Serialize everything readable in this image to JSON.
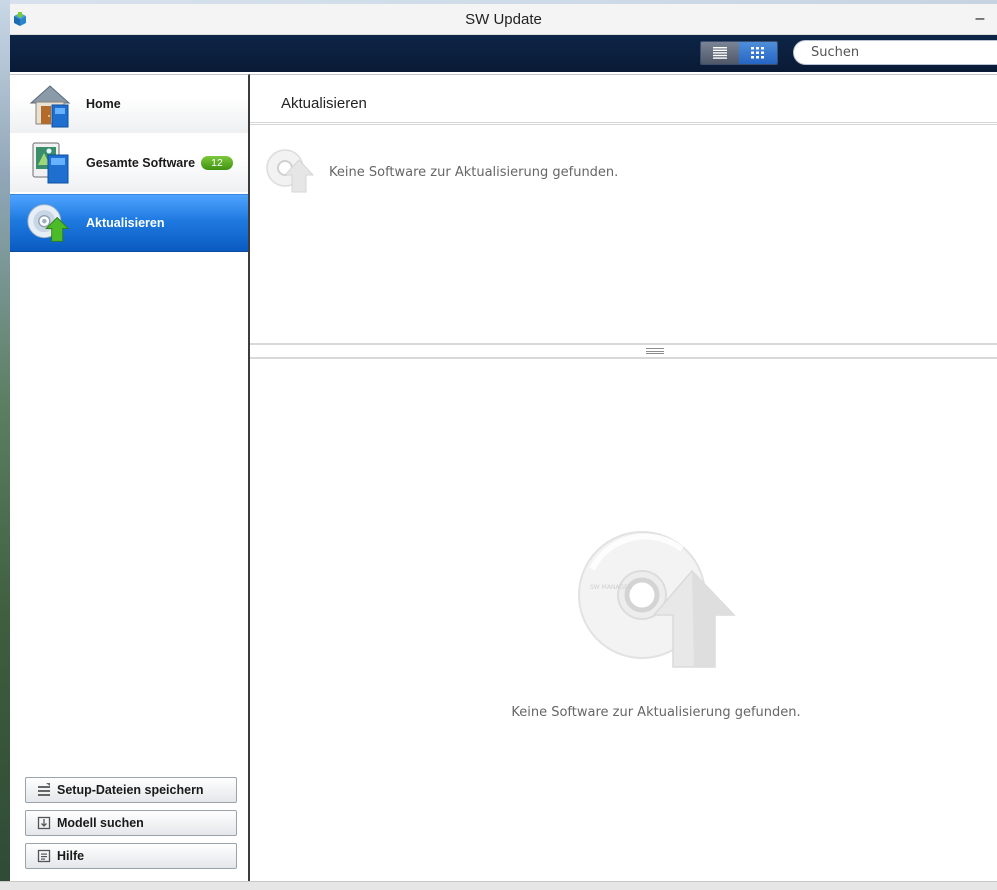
{
  "window": {
    "title": "SW Update",
    "minimize_symbol": "–"
  },
  "toolbar": {
    "views": [
      {
        "name": "list-view",
        "icon": "list-icon",
        "active": false
      },
      {
        "name": "grid-view",
        "icon": "grid-icon",
        "active": true
      }
    ],
    "search": {
      "placeholder": "Suchen",
      "value": ""
    }
  },
  "sidebar": {
    "items": [
      {
        "label": "Home",
        "icon": "home-icon",
        "selected": false
      },
      {
        "label": "Gesamte Software",
        "icon": "software-icon",
        "badge": "12",
        "selected": false
      },
      {
        "label": "Aktualisieren",
        "icon": "update-disc-icon",
        "selected": true
      }
    ],
    "buttons": [
      {
        "label": "Setup-Dateien speichern",
        "icon": "save-files-icon"
      },
      {
        "label": "Modell suchen",
        "icon": "model-search-icon"
      },
      {
        "label": "Hilfe",
        "icon": "help-icon"
      }
    ]
  },
  "main": {
    "title": "Aktualisieren",
    "upper_message": "Keine Software zur Aktualisierung gefunden.",
    "lower_message": "Keine Software zur Aktualisierung gefunden.",
    "disc_label": "SW MANAGER"
  },
  "colors": {
    "toolbar_bg": "#0e2547",
    "selected_item": "#1f7ae0",
    "badge": "#5aa823"
  }
}
